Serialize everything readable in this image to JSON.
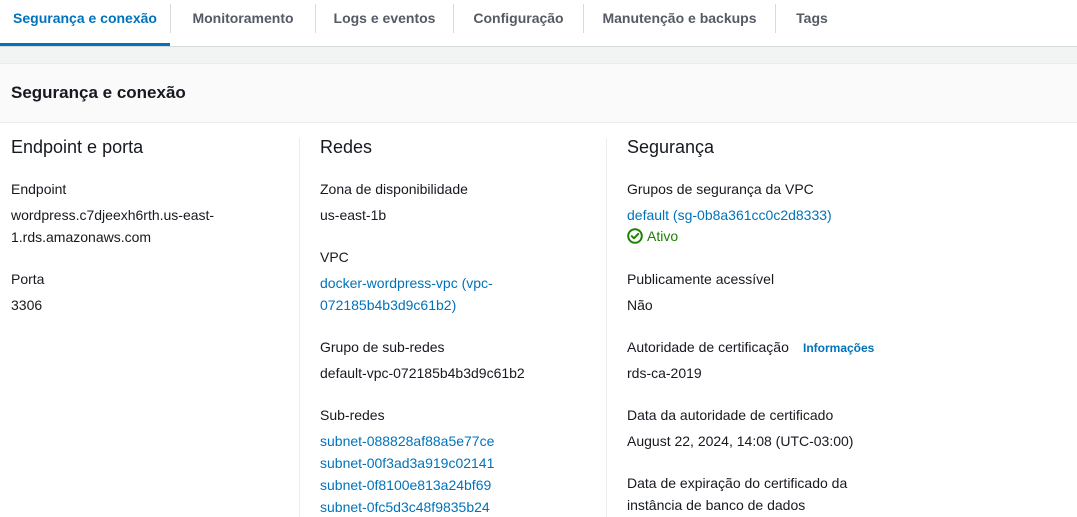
{
  "tabs": [
    {
      "label": "Segurança e conexão"
    },
    {
      "label": "Monitoramento"
    },
    {
      "label": "Logs e eventos"
    },
    {
      "label": "Configuração"
    },
    {
      "label": "Manutenção e backups"
    },
    {
      "label": "Tags"
    }
  ],
  "panel": {
    "title": "Segurança e conexão"
  },
  "endpoint_section": {
    "title": "Endpoint e porta",
    "endpoint_label": "Endpoint",
    "endpoint_line1": "wordpress.c7djeexh6rth.us-east-",
    "endpoint_line2": "1.rds.amazonaws.com",
    "port_label": "Porta",
    "port_value": "3306"
  },
  "network_section": {
    "title": "Redes",
    "az_label": "Zona de disponibilidade",
    "az_value": "us-east-1b",
    "vpc_label": "VPC",
    "vpc_line1": "docker-wordpress-vpc (vpc-",
    "vpc_line2": "072185b4b3d9c61b2)",
    "subnet_group_label": "Grupo de sub-redes",
    "subnet_group_value": "default-vpc-072185b4b3d9c61b2",
    "subnets_label": "Sub-redes",
    "subnets": [
      "subnet-088828af88a5e77ce",
      "subnet-00f3ad3a919c02141",
      "subnet-0f8100e813a24bf69",
      "subnet-0fc5d3c48f9835b24"
    ]
  },
  "security_section": {
    "title": "Segurança",
    "sg_label": "Grupos de segurança da VPC",
    "sg_link": "default (sg-0b8a361cc0c2d8333)",
    "sg_status": "Ativo",
    "public_label": "Publicamente acessível",
    "public_value": "Não",
    "ca_label": "Autoridade de certificação",
    "ca_info": "Informações",
    "ca_value": "rds-ca-2019",
    "ca_date_label": "Data da autoridade de certificado",
    "ca_date_value": "August 22, 2024, 14:08 (UTC-03:00)",
    "expiry_label_line1": "Data de expiração do certificado da",
    "expiry_label_line2": "instância de banco de dados"
  },
  "colors": {
    "accent": "#0073bb",
    "success": "#1d8102",
    "text": "#16191f"
  },
  "icons": {
    "status": "check-circle-icon"
  }
}
